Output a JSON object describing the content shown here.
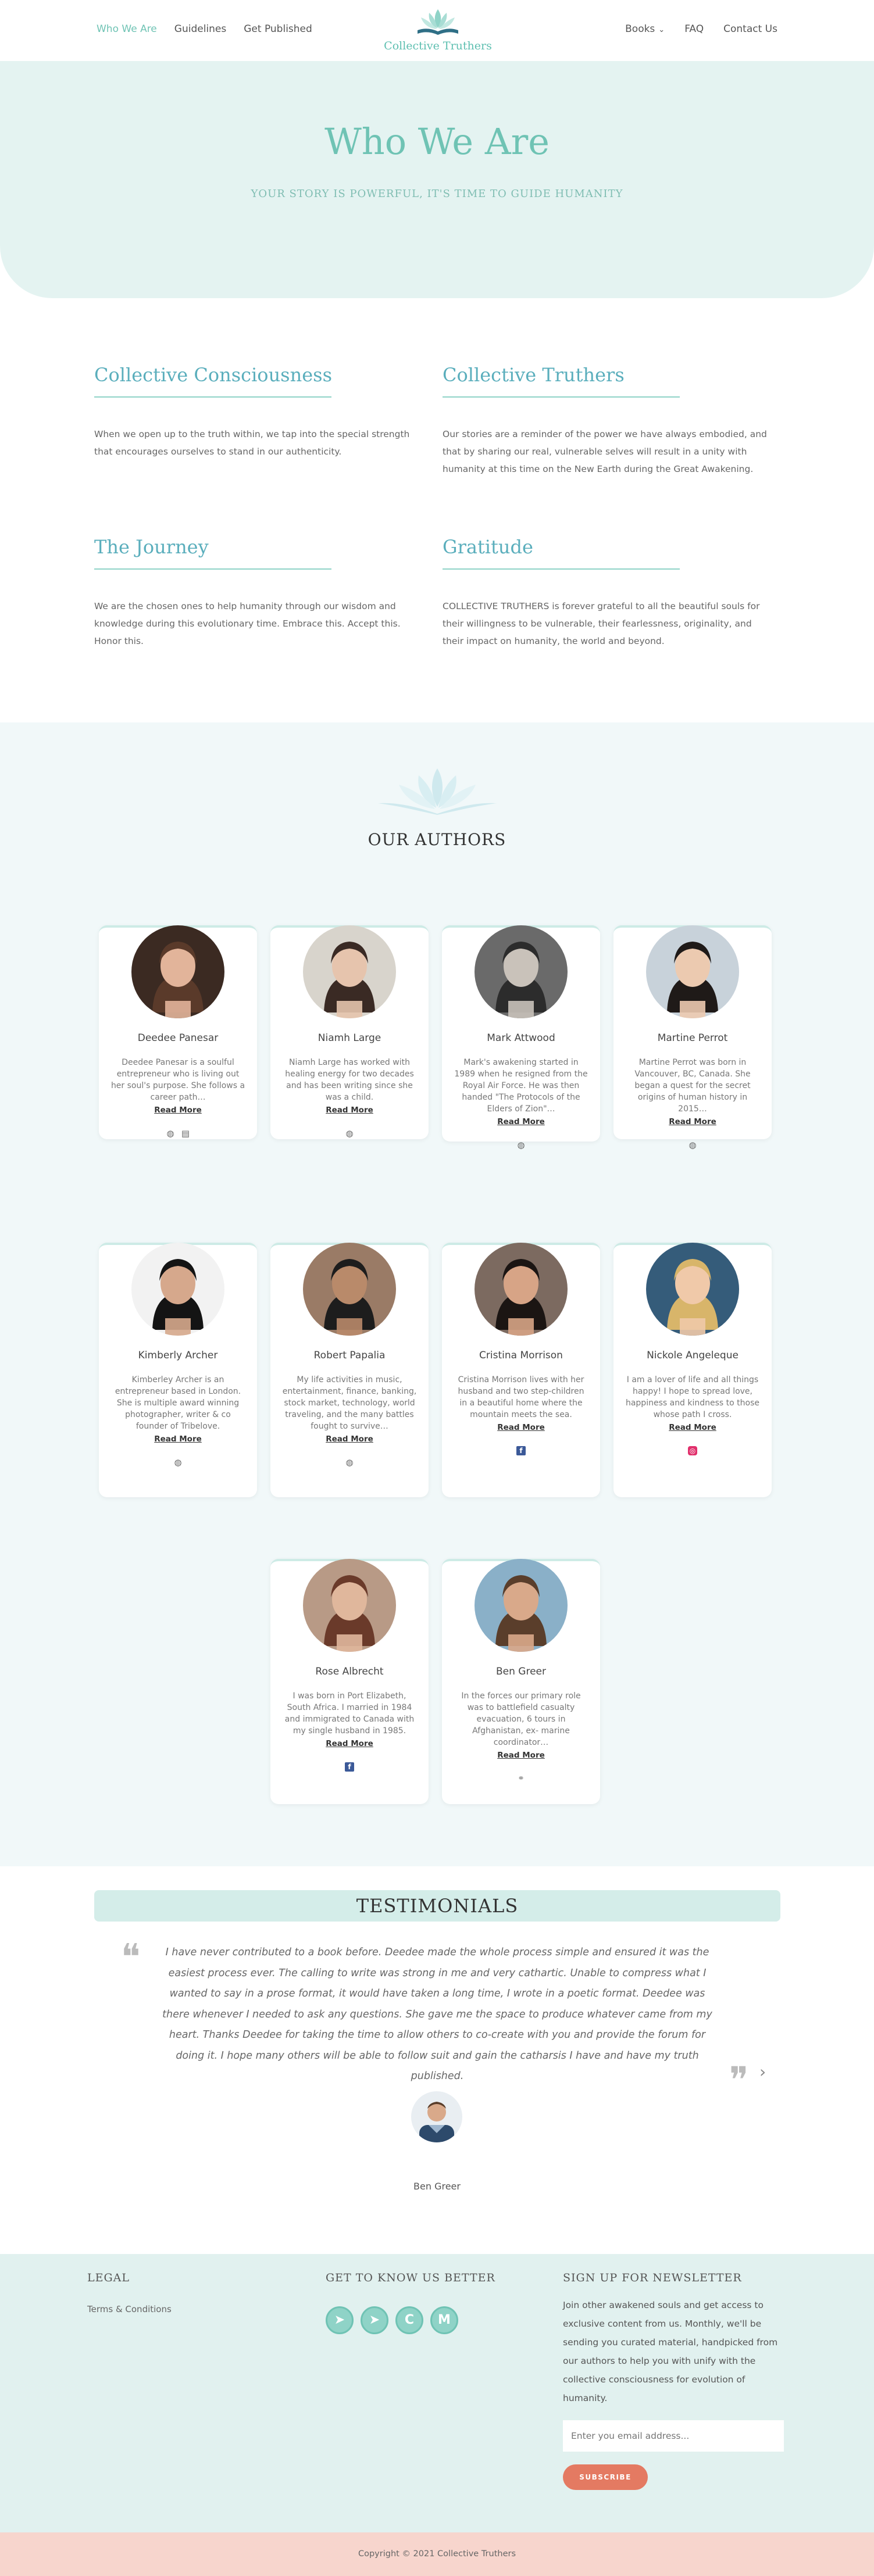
{
  "header": {
    "nav_left": [
      "Who We Are",
      "Guidelines",
      "Get Published"
    ],
    "nav_right": [
      "Books",
      "FAQ",
      "Contact Us"
    ],
    "logo_text": "Collective Truthers"
  },
  "hero": {
    "title": "Who We Are",
    "subtitle": "YOUR STORY IS POWERFUL, IT'S TIME TO GUIDE HUMANITY"
  },
  "about": [
    {
      "heading": "Collective Consciousness",
      "text": "When we open up to the truth within, we tap into the special strength that encourages ourselves to stand in our authenticity."
    },
    {
      "heading": "Collective Truthers",
      "text": "Our stories are a reminder of the power we have always embodied, and that by sharing our real, vulnerable selves will result in a unity with humanity at this time on the New Earth during the Great Awakening."
    },
    {
      "heading": "The Journey",
      "text": "We are the chosen ones to help humanity through our wisdom and knowledge during this evolutionary time. Embrace this. Accept this. Honor this."
    },
    {
      "heading": "Gratitude",
      "text": "COLLECTIVE TRUTHERS is forever grateful to all the beautiful souls for their willingness to be vulnerable, their fearlessness, originality, and their impact on humanity, the world and beyond."
    }
  ],
  "authors_title": "OUR AUTHORS",
  "read_more": "Read More",
  "authors": [
    {
      "name": "Deedee Panesar",
      "bio": "Deedee Panesar is a soulful entrepreneur who is living out her soul's purpose. She follows a career path…",
      "icons": [
        "globe-icon",
        "book-icon"
      ]
    },
    {
      "name": "Niamh Large",
      "bio": "Niamh Large has worked with healing energy for two decades and has been writing since she was a child.",
      "icons": [
        "globe-icon"
      ]
    },
    {
      "name": "Mark Attwood",
      "bio": "Mark's awakening started in 1989 when he resigned from the Royal Air Force. He was then handed \"The Protocols of the Elders of Zion\"…",
      "icons": [
        "globe-icon"
      ]
    },
    {
      "name": "Martine Perrot",
      "bio": "Martine Perrot was born in Vancouver, BC, Canada. She began a quest for the secret origins of human history in 2015…",
      "icons": [
        "globe-icon"
      ]
    },
    {
      "name": "Kimberly Archer",
      "bio": "Kimberley Archer is an entrepreneur based in London. She is multiple award winning photographer, writer & co founder of Tribelove.",
      "icons": [
        "globe-icon"
      ]
    },
    {
      "name": "Robert Papalia",
      "bio": "My life activities in music, entertainment, finance, banking, stock market, technology, world traveling, and the many battles fought to survive…",
      "icons": [
        "globe-icon"
      ]
    },
    {
      "name": "Cristina Morrison",
      "bio": "Cristina Morrison lives with her husband and two step-children in a beautiful home where the mountain meets the sea.",
      "icons": [
        "facebook-icon"
      ]
    },
    {
      "name": "Nickole Angeleque",
      "bio": "I am a lover of life and all things happy! I hope to spread love, happiness and kindness to those whose path I cross.",
      "icons": [
        "instagram-icon"
      ]
    },
    {
      "name": "Rose Albrecht",
      "bio": "I was born in Port Elizabeth, South Africa. I married in 1984 and immigrated to Canada with my single husband in 1985.",
      "icons": [
        "facebook-icon"
      ]
    },
    {
      "name": "Ben Greer",
      "bio": "In the forces our primary role was to battlefield casualty evacuation, 6 tours in Afghanistan, ex- marine coordinator…",
      "icons": [
        "link-icon"
      ]
    }
  ],
  "testimonials": {
    "title": "TESTIMONIALS",
    "quote": "I have never contributed to a book before. Deedee made the whole process simple and ensured it was the easiest process ever. The calling to write was strong in me and very cathartic. Unable to compress what I wanted to say in a prose format, it would have taken a long time, I wrote in a poetic format. Deedee was there whenever I needed to ask any questions. She gave me the space to produce whatever came from my heart. Thanks Deedee for taking the time to allow others to co-create with you and provide the forum for doing it. I hope many others will be able to follow suit and gain the catharsis I have and have my truth published.",
    "author": "Ben Greer"
  },
  "footer": {
    "legal_title": "LEGAL",
    "legal_link": "Terms & Conditions",
    "social_title": "GET TO KNOW US BETTER",
    "social_icons": [
      "telegram-icon",
      "telegram-icon",
      "c-icon",
      "medium-icon"
    ],
    "newsletter_title": "SIGN UP FOR NEWSLETTER",
    "newsletter_text": "Join other awakened souls and get access to exclusive content from us. Monthly, we'll be sending you curated material, handpicked from our authors to help you with unify with the collective consciousness for evolution of humanity.",
    "email_placeholder": "Enter you email address...",
    "subscribe_label": "SUBSCRIBE",
    "copyright": "Copyright © 2021 Collective Truthers"
  },
  "colors": {
    "accent": "#6fc3b4",
    "hero_bg": "#e4f3f1",
    "footer_bg": "#e1f1ef",
    "copyright_bg": "#f7d5cd",
    "button": "#e47a62"
  }
}
